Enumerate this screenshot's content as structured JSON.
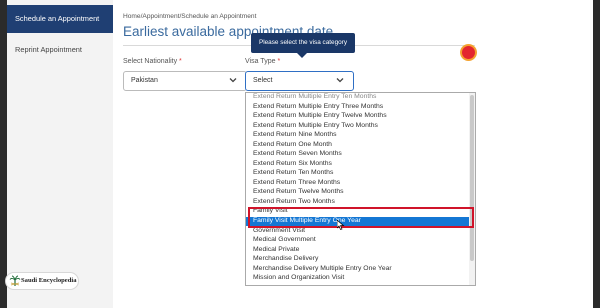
{
  "sidebar": {
    "items": [
      {
        "label": "Schedule an Appointment"
      },
      {
        "label": "Reprint Appointment"
      }
    ]
  },
  "main": {
    "breadcrumb": "Home/Appointment/Schedule an Appointment",
    "title": "Earliest available appointment date",
    "tooltip": "Please select the visa category",
    "nationality": {
      "label": "Select Nationality",
      "required_mark": "*",
      "value": "Pakistan"
    },
    "visa_type": {
      "label": "Visa Type",
      "required_mark": "*",
      "value": "Select"
    }
  },
  "dropdown": {
    "options": [
      "Extend Return Multiple Entry Ten Months",
      "Extend Return Multiple Entry Three Months",
      "Extend Return Multiple Entry Twelve Months",
      "Extend Return Multiple Entry Two Months",
      "Extend Return Nine Months",
      "Extend Return One Month",
      "Extend Return Seven Months",
      "Extend Return Six Months",
      "Extend Return Ten Months",
      "Extend Return Three Months",
      "Extend Return Twelve Months",
      "Extend Return Two Months",
      "Family Visit",
      "Family Visit Multiple Entry One Year",
      "Government Visit",
      "Medical Government",
      "Medical Private",
      "Merchandise Delivery",
      "Merchandise Delivery Multiple Entry One Year",
      "Mission and Organization Visit"
    ],
    "selected": "Family Visit Multiple Entry One Year"
  },
  "watermark": {
    "text": "Saudi Encyclopedia"
  },
  "colors": {
    "sidebar_active": "#1f3f73",
    "highlight": "#1477d4",
    "annotation": "#d0142a",
    "title": "#3a6a9e"
  }
}
